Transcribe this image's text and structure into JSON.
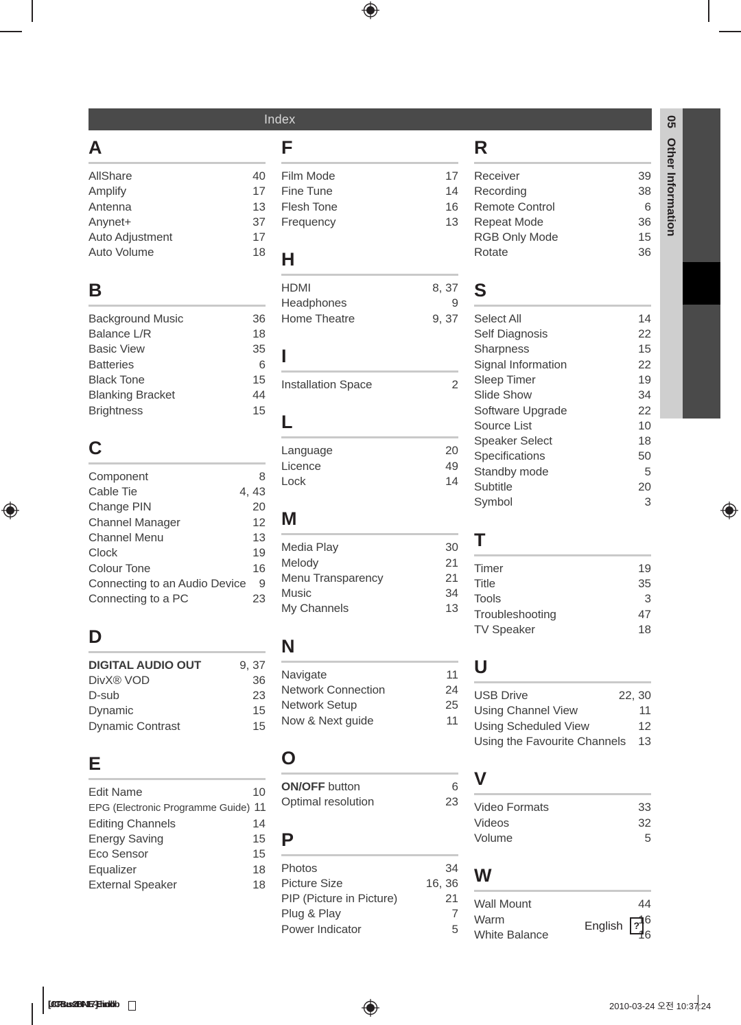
{
  "header": {
    "title": "Index"
  },
  "side_tab": {
    "number": "05",
    "label": "Other Information"
  },
  "language_marker": {
    "label": "English",
    "glyph": "?"
  },
  "footer": {
    "file_line_1": "UCBusBNE-Eindb",
    "file_line_2": "[CRus2H-17].hdb",
    "file_glyph": "",
    "date": "2010-03-24  오전 10:37:24"
  },
  "index": {
    "columns": [
      {
        "name": "column-left",
        "groups": [
          {
            "letter": "A",
            "entries": [
              {
                "name": "AllShare",
                "page": "40"
              },
              {
                "name": "Amplify",
                "page": "17"
              },
              {
                "name": "Antenna",
                "page": "13"
              },
              {
                "name": "Anynet+",
                "page": "37"
              },
              {
                "name": "Auto Adjustment",
                "page": "17"
              },
              {
                "name": "Auto Volume",
                "page": "18"
              }
            ]
          },
          {
            "letter": "B",
            "entries": [
              {
                "name": "Background Music",
                "page": "36"
              },
              {
                "name": "Balance  L/R",
                "page": "18"
              },
              {
                "name": "Basic View",
                "page": "35"
              },
              {
                "name": "Batteries",
                "page": "6"
              },
              {
                "name": "Black Tone",
                "page": "15"
              },
              {
                "name": "Blanking Bracket",
                "page": "44"
              },
              {
                "name": "Brightness",
                "page": "15"
              }
            ]
          },
          {
            "letter": "C",
            "entries": [
              {
                "name": "Component",
                "page": "8"
              },
              {
                "name": "Cable Tie",
                "page": "4, 43"
              },
              {
                "name": "Change PIN",
                "page": "20"
              },
              {
                "name": "Channel Manager",
                "page": "12"
              },
              {
                "name": "Channel Menu",
                "page": "13"
              },
              {
                "name": "Clock",
                "page": "19"
              },
              {
                "name": "Colour Tone",
                "page": "16"
              },
              {
                "name": "Connecting to an Audio Device",
                "page": "9"
              },
              {
                "name": "Connecting to a PC",
                "page": "23"
              }
            ]
          },
          {
            "letter": "D",
            "entries": [
              {
                "name": "DIGITAL AUDIO OUT",
                "page": "9, 37",
                "bold": true
              },
              {
                "name": "DivX® VOD",
                "page": "36"
              },
              {
                "name": "D-sub",
                "page": "23"
              },
              {
                "name": "Dynamic",
                "page": "15"
              },
              {
                "name": "Dynamic Contrast",
                "page": "15"
              }
            ]
          },
          {
            "letter": "E",
            "entries": [
              {
                "name": "Edit Name",
                "page": "10"
              },
              {
                "name": "EPG (Electronic Programme Guide)",
                "page": "11",
                "small": true
              },
              {
                "name": "Editing Channels",
                "page": "14"
              },
              {
                "name": "Energy Saving",
                "page": "15"
              },
              {
                "name": "Eco Sensor",
                "page": "15"
              },
              {
                "name": "Equalizer",
                "page": "18"
              },
              {
                "name": "External Speaker",
                "page": "18"
              }
            ]
          }
        ]
      },
      {
        "name": "column-middle",
        "groups": [
          {
            "letter": "F",
            "entries": [
              {
                "name": "Film Mode",
                "page": "17"
              },
              {
                "name": "Fine Tune",
                "page": "14"
              },
              {
                "name": "Flesh Tone",
                "page": "16"
              },
              {
                "name": "Frequency",
                "page": "13"
              }
            ]
          },
          {
            "letter": "H",
            "entries": [
              {
                "name": "HDMI",
                "page": "8, 37"
              },
              {
                "name": "Headphones",
                "page": "9"
              },
              {
                "name": "Home Theatre",
                "page": "9, 37"
              }
            ]
          },
          {
            "letter": "I",
            "entries": [
              {
                "name": "Installation Space",
                "page": "2"
              }
            ]
          },
          {
            "letter": "L",
            "entries": [
              {
                "name": "Language",
                "page": "20"
              },
              {
                "name": "Licence",
                "page": "49"
              },
              {
                "name": "Lock",
                "page": "14"
              }
            ]
          },
          {
            "letter": "M",
            "entries": [
              {
                "name": "Media Play",
                "page": "30"
              },
              {
                "name": "Melody",
                "page": "21"
              },
              {
                "name": "Menu Transparency",
                "page": "21"
              },
              {
                "name": "Music",
                "page": "34"
              },
              {
                "name": "My Channels",
                "page": "13"
              }
            ]
          },
          {
            "letter": "N",
            "entries": [
              {
                "name": "Navigate",
                "page": "11"
              },
              {
                "name": "Network Connection",
                "page": "24"
              },
              {
                "name": "Network Setup",
                "page": "25"
              },
              {
                "name": "Now & Next guide",
                "page": "11"
              }
            ]
          },
          {
            "letter": "O",
            "entries": [
              {
                "name": "ON/OFF button",
                "page": "6",
                "bold_prefix": "ON/OFF",
                "rest": " button"
              },
              {
                "name": "Optimal resolution",
                "page": "23"
              }
            ]
          },
          {
            "letter": "P",
            "entries": [
              {
                "name": "Photos",
                "page": "34"
              },
              {
                "name": "Picture Size",
                "page": "16, 36"
              },
              {
                "name": "PIP (Picture in Picture)",
                "page": "21"
              },
              {
                "name": "Plug & Play",
                "page": "7"
              },
              {
                "name": "Power Indicator",
                "page": "5"
              }
            ]
          }
        ]
      },
      {
        "name": "column-right",
        "groups": [
          {
            "letter": "R",
            "entries": [
              {
                "name": "Receiver",
                "page": "39"
              },
              {
                "name": "Recording",
                "page": "38"
              },
              {
                "name": "Remote Control",
                "page": "6"
              },
              {
                "name": "Repeat Mode",
                "page": "36"
              },
              {
                "name": "RGB Only Mode",
                "page": "15"
              },
              {
                "name": "Rotate",
                "page": "36"
              }
            ]
          },
          {
            "letter": "S",
            "entries": [
              {
                "name": "Select All",
                "page": "14"
              },
              {
                "name": "Self Diagnosis",
                "page": "22"
              },
              {
                "name": "Sharpness",
                "page": "15"
              },
              {
                "name": "Signal Information",
                "page": "22"
              },
              {
                "name": "Sleep Timer",
                "page": "19"
              },
              {
                "name": "Slide Show",
                "page": "34"
              },
              {
                "name": "Software Upgrade",
                "page": "22"
              },
              {
                "name": "Source List",
                "page": "10"
              },
              {
                "name": "Speaker Select",
                "page": "18"
              },
              {
                "name": "Specifications",
                "page": "50"
              },
              {
                "name": "Standby mode",
                "page": "5"
              },
              {
                "name": "Subtitle",
                "page": "20"
              },
              {
                "name": "Symbol",
                "page": "3"
              }
            ]
          },
          {
            "letter": "T",
            "entries": [
              {
                "name": "Timer",
                "page": "19"
              },
              {
                "name": "Title",
                "page": "35"
              },
              {
                "name": "Tools",
                "page": "3"
              },
              {
                "name": "Troubleshooting",
                "page": "47"
              },
              {
                "name": "TV Speaker",
                "page": "18"
              }
            ]
          },
          {
            "letter": "U",
            "entries": [
              {
                "name": "USB Drive",
                "page": "22, 30"
              },
              {
                "name": "Using Channel View",
                "page": "11"
              },
              {
                "name": "Using Scheduled View",
                "page": "12"
              },
              {
                "name": "Using the Favourite Channels",
                "page": "13"
              }
            ]
          },
          {
            "letter": "V",
            "entries": [
              {
                "name": "Video Formats",
                "page": "33"
              },
              {
                "name": "Videos",
                "page": "32"
              },
              {
                "name": "Volume",
                "page": "5"
              }
            ]
          },
          {
            "letter": "W",
            "entries": [
              {
                "name": "Wall Mount",
                "page": "44"
              },
              {
                "name": "Warm",
                "page": "16"
              },
              {
                "name": "White Balance",
                "page": "16"
              }
            ]
          }
        ]
      }
    ]
  }
}
